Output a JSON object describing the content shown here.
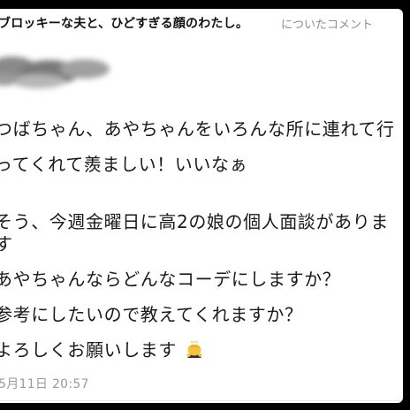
{
  "header": {
    "article_title": "ブロッキーな夫と、ひどすぎる顔のわたし。",
    "suffix": "についたコメント"
  },
  "commenter": {
    "name_obscured": true
  },
  "comment": {
    "lines": [
      "つばちゃん、あやちゃんをいろんな所に連れて行",
      "ってくれて羨ましい！いいなぁ",
      "",
      "そう、今週金曜日に高2の娘の個人面談がありま",
      "す",
      "あやちゃんならどんなコーデにしますか？",
      "参考にしたいので教えてくれますか？",
      "よろしくお願いします"
    ],
    "trailing_emoji": "bowing-person-emoji"
  },
  "timestamp": "5月11日 20:57"
}
